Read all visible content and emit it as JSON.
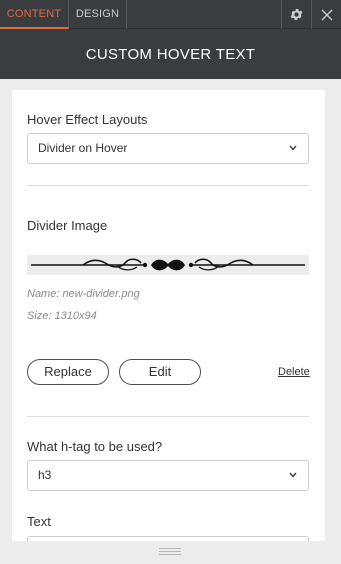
{
  "tabs": {
    "content": "CONTENT",
    "design": "DESIGN"
  },
  "icons": {
    "settings": "gear-icon",
    "close": "close-icon",
    "chevron": "chevron-down-icon",
    "resize": "grip-icon"
  },
  "colors": {
    "accent": "#e26a43",
    "header_bg": "#3a3d40",
    "panel_bg": "#ececec"
  },
  "panel": {
    "title": "CUSTOM HOVER TEXT"
  },
  "form": {
    "hover_layout": {
      "label": "Hover Effect Layouts",
      "value": "Divider on Hover"
    },
    "divider_image": {
      "label": "Divider Image",
      "name": "Name: new-divider.png",
      "size": "Size: 1310x94",
      "replace_label": "Replace",
      "edit_label": "Edit",
      "delete_label": "Delete"
    },
    "htag": {
      "label": "What h-tag to be used?",
      "value": "h3"
    },
    "text": {
      "label": "Text"
    }
  }
}
